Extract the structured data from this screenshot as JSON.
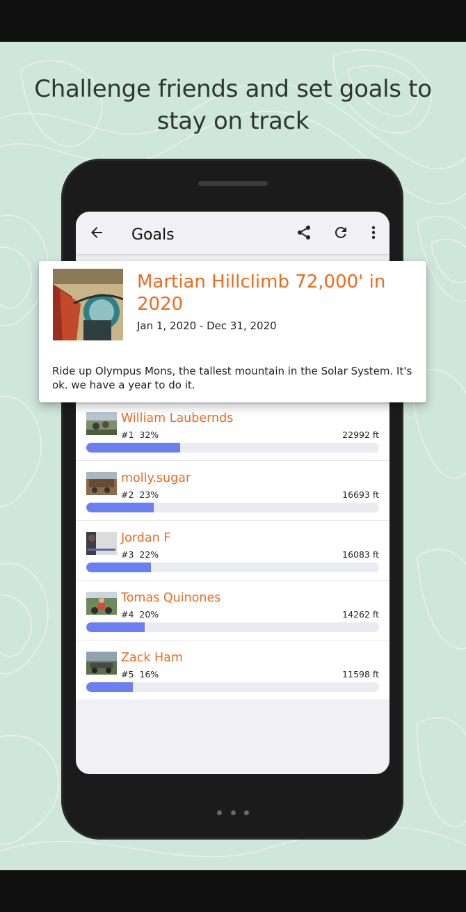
{
  "promo": {
    "headline": "Challenge friends and set goals to stay on track"
  },
  "appbar": {
    "title": "Goals",
    "icons": [
      "arrow-back-icon",
      "share-icon",
      "refresh-icon",
      "more-vert-icon"
    ]
  },
  "challenge": {
    "title": "Martian Hillclimb 72,000' in 2020",
    "dates": "Jan 1, 2020 - Dec 31, 2020",
    "description": "Ride up Olympus Mons, the tallest mountain in the Solar System. It's ok. we have a year to do it."
  },
  "leaderboard": [
    {
      "name": "William Laubernds",
      "rank": "#1",
      "percent": "32%",
      "progress": 0.32,
      "distance": "22992 ft"
    },
    {
      "name": "molly.sugar",
      "rank": "#2",
      "percent": "23%",
      "progress": 0.23,
      "distance": "16693 ft"
    },
    {
      "name": "Jordan F",
      "rank": "#3",
      "percent": "22%",
      "progress": 0.22,
      "distance": "16083 ft"
    },
    {
      "name": "Tomas Quinones",
      "rank": "#4",
      "percent": "20%",
      "progress": 0.2,
      "distance": "14262 ft"
    },
    {
      "name": "Zack Ham",
      "rank": "#5",
      "percent": "16%",
      "progress": 0.16,
      "distance": "11598 ft"
    }
  ],
  "colors": {
    "background": "#cfe6dc",
    "accent_orange": "#ee6a1c",
    "progress_fill": "#6b7ff5",
    "progress_track": "#ebebf2"
  }
}
